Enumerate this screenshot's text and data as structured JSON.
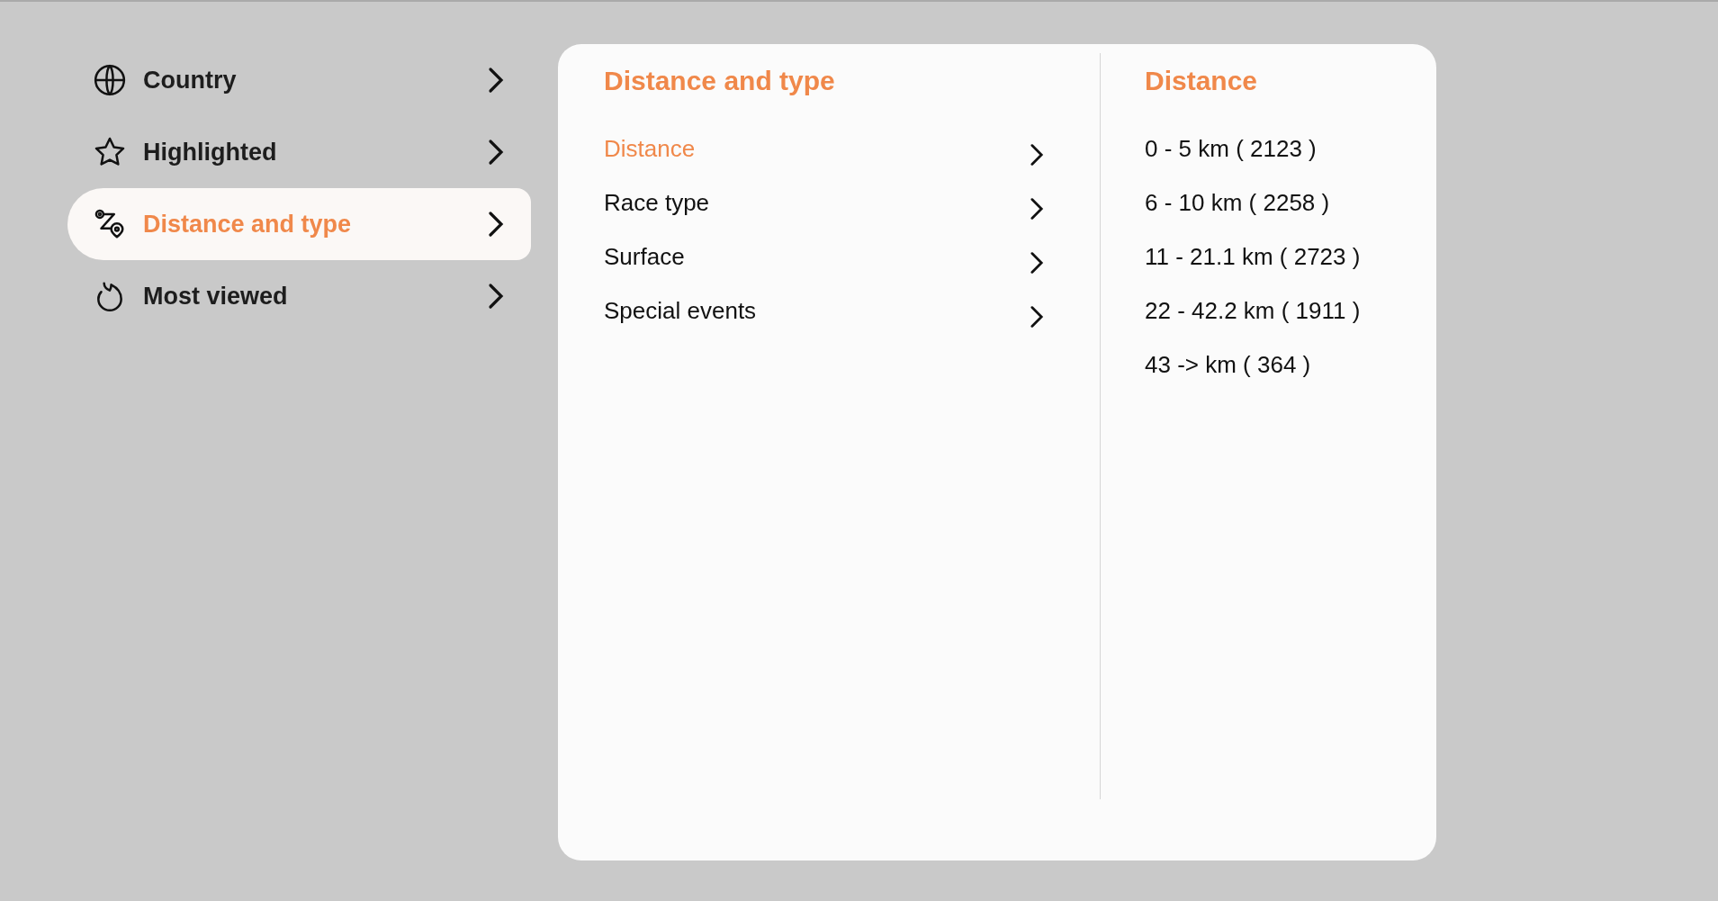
{
  "sidebar": {
    "items": [
      {
        "kind": "globe",
        "label": "Country",
        "selected": false
      },
      {
        "kind": "star",
        "label": "Highlighted",
        "selected": false
      },
      {
        "kind": "route",
        "label": "Distance and type",
        "selected": true
      },
      {
        "kind": "flame",
        "label": "Most viewed",
        "selected": false
      }
    ]
  },
  "panel": {
    "title": "Distance and type",
    "categories": [
      {
        "label": "Distance",
        "selected": true
      },
      {
        "label": "Race type",
        "selected": false
      },
      {
        "label": "Surface",
        "selected": false
      },
      {
        "label": "Special events",
        "selected": false
      }
    ],
    "options": {
      "title": "Distance",
      "items": [
        "0 - 5 km ( 2123 )",
        "6 - 10 km ( 2258 )",
        "11 - 21.1 km ( 2723 )",
        "22 - 42.2 km ( 1911 )",
        "43 -> km ( 364 )"
      ]
    }
  }
}
